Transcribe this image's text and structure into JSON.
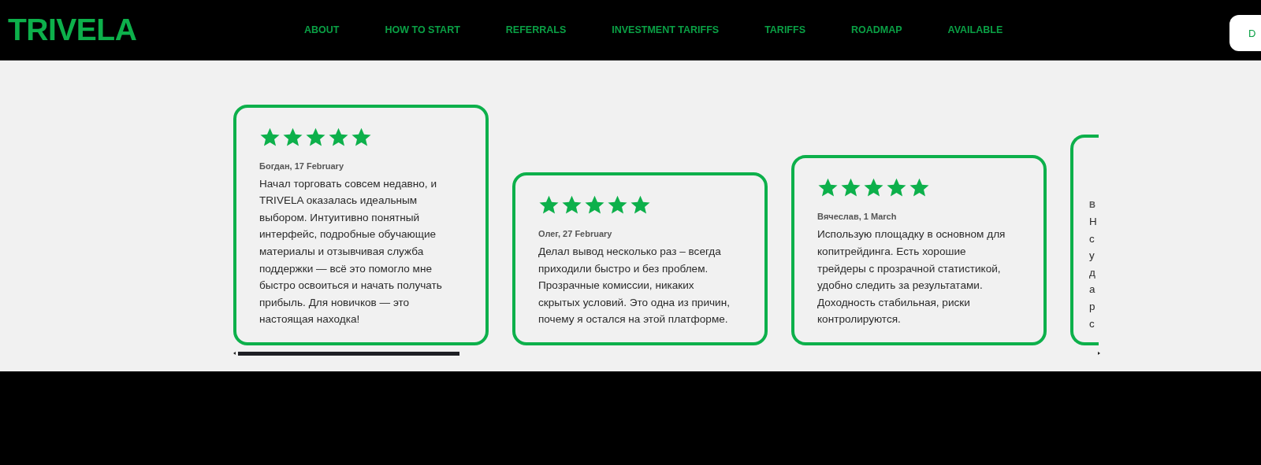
{
  "header": {
    "logo": "TRIVELA",
    "nav": [
      {
        "label": "ABOUT"
      },
      {
        "label": "HOW TO START"
      },
      {
        "label": "REFERRALS"
      },
      {
        "label": "INVESTMENT TARIFFS"
      },
      {
        "label": "TARIFFS"
      },
      {
        "label": "ROADMAP"
      },
      {
        "label": "AVAILABLE"
      }
    ],
    "cta_button": {
      "label": "D"
    }
  },
  "reviews": [
    {
      "stars": 5,
      "author": "Богдан, 17 February",
      "text": "Начал торговать совсем недавно, и TRIVELA оказалась идеальным выбором. Интуитивно понятный интерфейс, подробные обучающие материалы и отзывчивая служба поддержки — всё это помогло мне быстро освоиться и начать получать прибыль. Для новичков — это настоящая находка!"
    },
    {
      "stars": 5,
      "author": "Олег, 27 February",
      "text": "Делал вывод несколько раз – всегда приходили быстро и без проблем. Прозрачные комиссии, никаких скрытых условий. Это одна из причин, почему я остался на этой платформе."
    },
    {
      "stars": 5,
      "author": "Вячеслав, 1 March",
      "text": "Использую площадку в основном для копитрейдинга. Есть хорошие трейдеры с прозрачной статистикой, удобно следить за результатами. Доходность стабильная, риски контролируются."
    },
    {
      "author": "В",
      "text_lines": [
        "Н",
        "с",
        "у",
        "д",
        "а",
        "р",
        "с"
      ]
    }
  ]
}
